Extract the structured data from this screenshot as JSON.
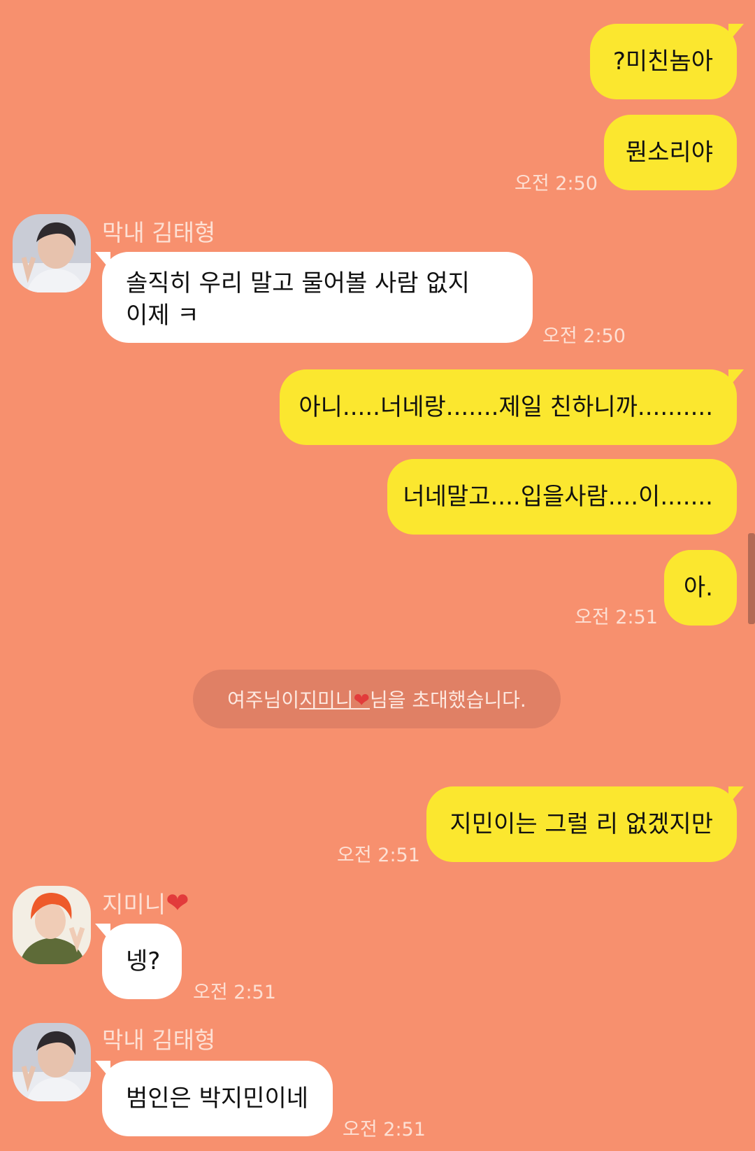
{
  "colors": {
    "background": "#f7906e",
    "my_bubble": "#fbe72f",
    "other_bubble": "#ffffff",
    "meta_text": "#fde0d4",
    "heart": "#e23b3b"
  },
  "messages": [
    {
      "from": "me",
      "text": "?미친놈아"
    },
    {
      "from": "me",
      "text": "뭔소리야",
      "time": "오전 2:50"
    },
    {
      "from": "taehyung",
      "sender": "막내 김태형",
      "line1": "솔직히 우리 말고 물어볼 사람 없지",
      "line2": "이제 ㅋ",
      "time": "오전 2:50"
    },
    {
      "from": "me",
      "text": "아니.....너네랑.......제일 친하니까.........."
    },
    {
      "from": "me",
      "text": "너네말고....입을사람....이......."
    },
    {
      "from": "me",
      "text": "아.",
      "time": "오전 2:51"
    },
    {
      "from": "me",
      "text": "지민이는 그럴 리 없겠지만",
      "time": "오전 2:51"
    },
    {
      "from": "jimin",
      "sender": "지미니",
      "sender_heart": "❤",
      "text": "넹?",
      "time": "오전 2:51"
    },
    {
      "from": "taehyung",
      "sender": "막내 김태형",
      "text": "범인은 박지민이네",
      "time": "오전 2:51"
    }
  ],
  "system_notice": {
    "before": "여주님이 ",
    "name": "지미니",
    "heart": "❤",
    "after": "님을 초대했습니다."
  },
  "icons": {
    "avatar_taehyung": "avatar-photo",
    "avatar_jimin": "avatar-photo"
  }
}
